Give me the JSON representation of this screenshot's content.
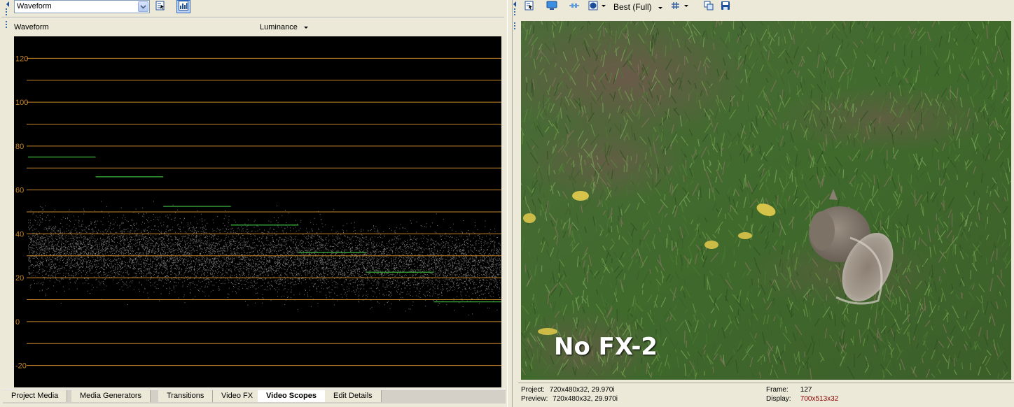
{
  "scopes_panel": {
    "scope_type_select": "Waveform",
    "scope_title": "Waveform",
    "channel_select": "Luminance",
    "y_ticks": [
      "120",
      "100",
      "80",
      "60",
      "40",
      "20",
      "0",
      "-20"
    ],
    "tabs": [
      {
        "label": "Project Media"
      },
      {
        "label": "Media Generators"
      },
      {
        "label": "Transitions"
      },
      {
        "label": "Video FX"
      },
      {
        "label": "Video Scopes"
      },
      {
        "label": "Edit Details"
      }
    ],
    "selected_tab": "Video Scopes"
  },
  "preview_panel": {
    "quality_select": "Best (Full)",
    "overlay_text": "No FX-2",
    "status": {
      "project_label": "Project:",
      "project_value": "720x480x32, 29.970i",
      "preview_label": "Preview:",
      "preview_value": "720x480x32, 29.970i",
      "frame_label": "Frame:",
      "frame_value": "127",
      "display_label": "Display:",
      "display_value": "700x513x32"
    }
  },
  "colors": {
    "accent": "#316ac5",
    "grid_line": "#c8862a",
    "display_value": "#8b0000",
    "marker": "#3aa83a"
  }
}
